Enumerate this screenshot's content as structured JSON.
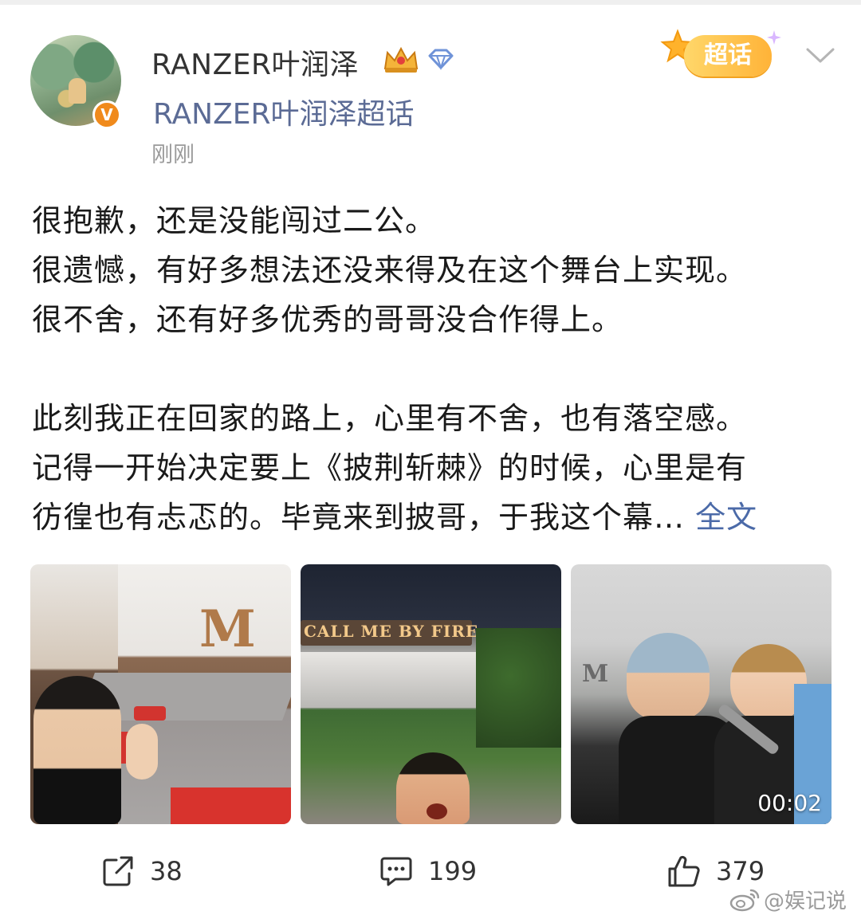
{
  "author": {
    "name": "RANZER叶润泽",
    "supertopic": "RANZER叶润泽超话",
    "timestamp": "刚刚",
    "verified_badge": "V"
  },
  "badge": {
    "label": "超话"
  },
  "post": {
    "lines": [
      "很抱歉，还是没能闯过二公。",
      "很遗憾，有好多想法还没来得及在这个舞台上实现。",
      "很不舍，还有好多优秀的哥哥没合作得上。",
      "",
      "此刻我正在回家的路上，心里有不舍，也有落空感。",
      "记得一开始决定要上《披荆斩棘》的时候，心里是有",
      "彷徨也有忐忑的。毕竟来到披哥，于我这个幕…"
    ],
    "full_text_link": "全文"
  },
  "media": {
    "video_duration": "00:02",
    "sign_text": "CALL ME BY FIRE"
  },
  "actions": {
    "share_count": "38",
    "comment_count": "199",
    "like_count": "379"
  },
  "watermark": "@娱记说",
  "colors": {
    "link": "#4b6aa8",
    "supertopic": "#5b6b95",
    "badge_orange": "#f08a1c",
    "pill_gold": "#ffb338"
  }
}
